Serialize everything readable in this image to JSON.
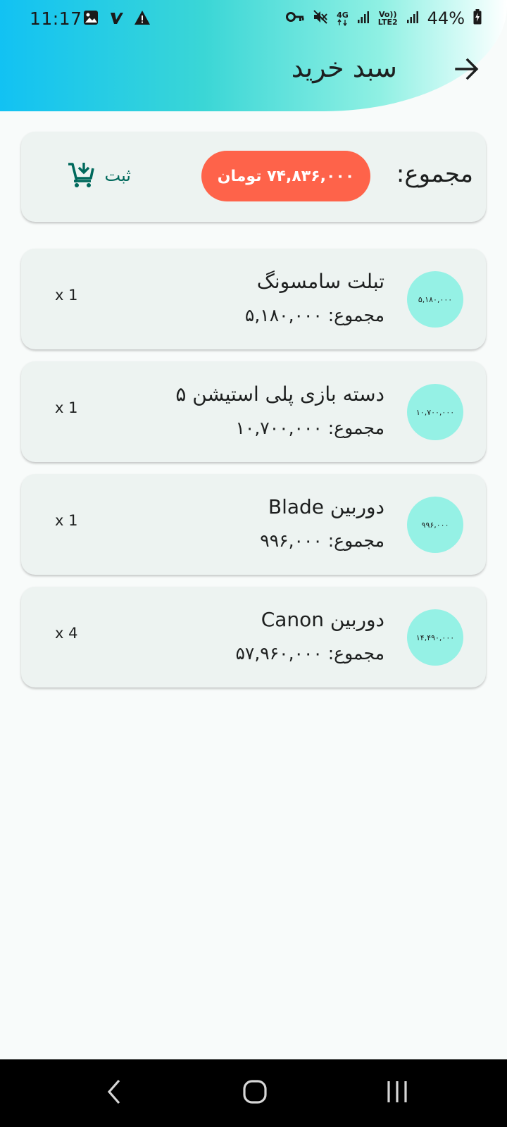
{
  "status_bar": {
    "time": "11:17",
    "battery": "44%",
    "network": "4G",
    "volte_top": "Vo))",
    "volte_bottom": "LTE2"
  },
  "app_bar": {
    "title": "سبد خرید"
  },
  "summary": {
    "label": "مجموع:",
    "total": "۷۴,۸۳۶,۰۰۰ تومان",
    "checkout_label": "ثبت"
  },
  "cart_items": [
    {
      "name": "تبلت سامسونگ",
      "unit_price": "۵,۱۸۰,۰۰۰",
      "total": "مجموع: ۵,۱۸۰,۰۰۰",
      "quantity": "x 1"
    },
    {
      "name": "دسته بازی پلی استیشن ۵",
      "unit_price": "۱۰,۷۰۰,۰۰۰",
      "total": "مجموع: ۱۰,۷۰۰,۰۰۰",
      "quantity": "x 1"
    },
    {
      "name": "دوربین Blade",
      "unit_price": "۹۹۶,۰۰۰",
      "total": "مجموع: ۹۹۶,۰۰۰",
      "quantity": "x 1"
    },
    {
      "name": "دوربین Canon",
      "unit_price": "۱۴,۴۹۰,۰۰۰",
      "total": "مجموع: ۵۷,۹۶۰,۰۰۰",
      "quantity": "x 4"
    }
  ],
  "colors": {
    "total_pill": "#fe634a",
    "badge": "#95f1e5",
    "checkout": "#00695c"
  },
  "icons": [
    "back-arrow-icon",
    "add-shopping-cart-icon",
    "nav-back-icon",
    "nav-home-icon",
    "nav-recents-icon"
  ]
}
